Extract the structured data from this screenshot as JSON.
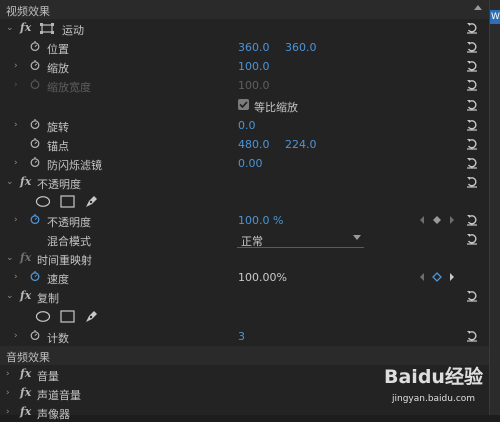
{
  "video_effects": {
    "title": "视频效果"
  },
  "motion": {
    "title": "运动",
    "position": {
      "label": "位置",
      "x": "360.0",
      "y": "360.0"
    },
    "scale": {
      "label": "缩放",
      "value": "100.0"
    },
    "scale_width": {
      "label": "缩放宽度",
      "value": "100.0"
    },
    "uniform_scale": {
      "label": "等比缩放",
      "checked": true
    },
    "rotation": {
      "label": "旋转",
      "value": "0.0"
    },
    "anchor": {
      "label": "锚点",
      "x": "480.0",
      "y": "224.0"
    },
    "anti_flicker": {
      "label": "防闪烁滤镜",
      "value": "0.00"
    }
  },
  "opacity": {
    "title": "不透明度",
    "opacity_prop": {
      "label": "不透明度",
      "value": "100.0 %"
    },
    "blend": {
      "label": "混合模式",
      "value": "正常"
    }
  },
  "time_remap": {
    "title": "时间重映射",
    "speed": {
      "label": "速度",
      "value": "100.00%"
    }
  },
  "copy": {
    "title": "复制",
    "count": {
      "label": "计数",
      "value": "3"
    }
  },
  "audio_effects": {
    "title": "音频效果",
    "items": [
      "音量",
      "声道音量",
      "声像器"
    ]
  },
  "right_tab": {
    "label": "W"
  },
  "watermark": {
    "brand": "Baidu经验",
    "url": "jingyan.baidu.com"
  },
  "colors": {
    "accent_value": "#4d94d6",
    "panel_bg": "#232323",
    "section_bg": "#2a2a2a"
  }
}
